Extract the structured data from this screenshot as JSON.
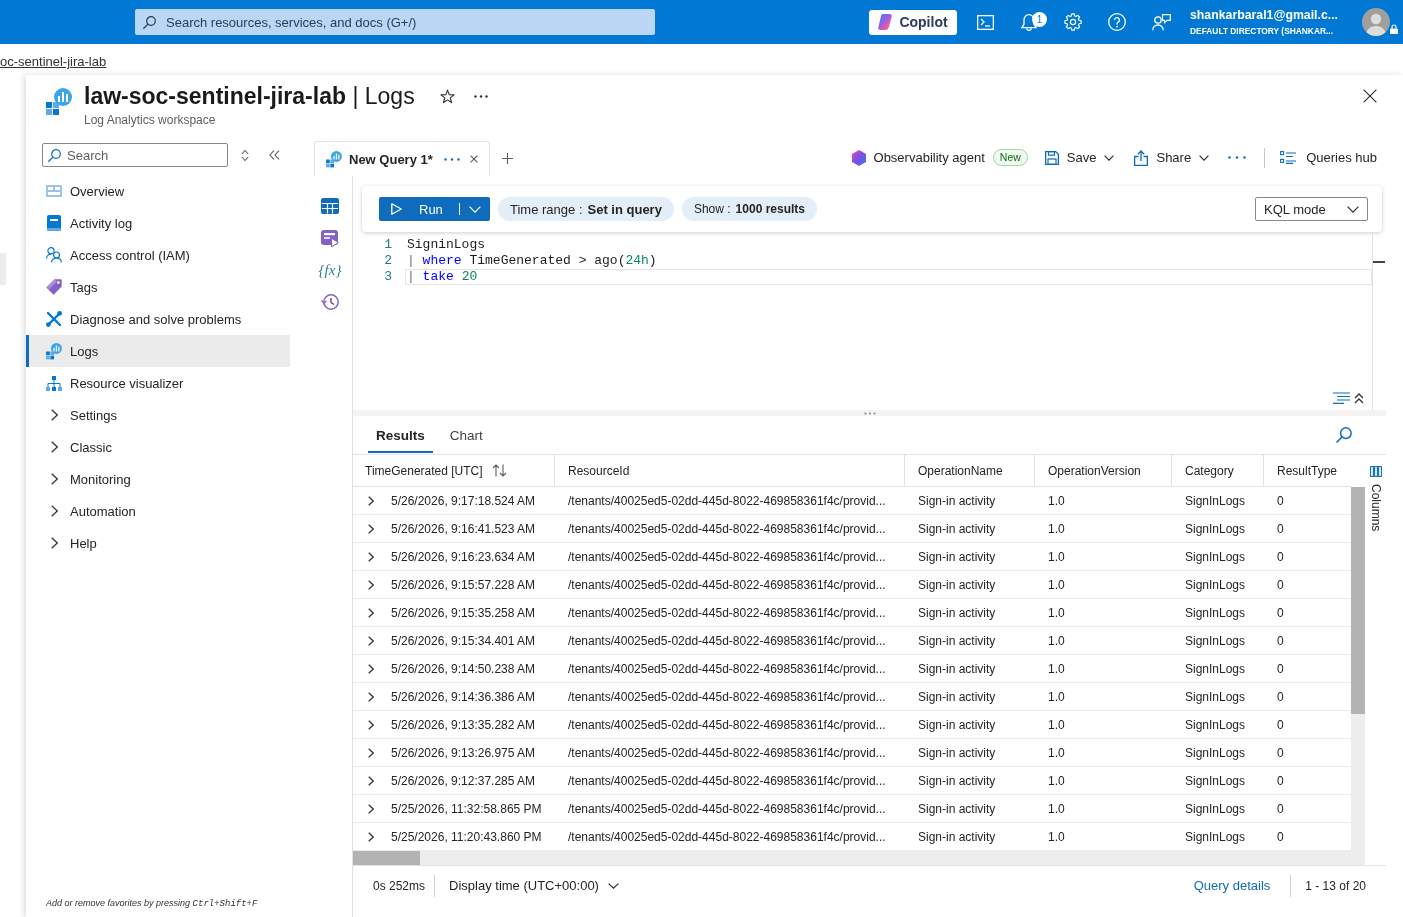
{
  "top_bar": {
    "search": {
      "placeholder": "Search resources, services, and docs (G+/)"
    },
    "copilot": "Copilot",
    "notification_count": "1",
    "account": {
      "email": "shankarbaral1@gmail.c...",
      "directory": "DEFAULT DIRECTORY (SHANKAR..."
    }
  },
  "breadcrumb": [
    {
      "label": "oc-sentinel-jira-lab"
    }
  ],
  "header": {
    "title": "**law-soc-sentinel-jira-lab** | Logs",
    "subtitle": "Log Analytics workspace"
  },
  "sidebar": {
    "search": {
      "placeholder": "Search"
    },
    "items": [
      {
        "label": "Overview",
        "kind": "link",
        "selected": false
      },
      {
        "label": "Activity log",
        "kind": "link",
        "selected": false
      },
      {
        "label": "Access control (IAM)",
        "kind": "link",
        "selected": false
      },
      {
        "label": "Tags",
        "kind": "link",
        "selected": false
      },
      {
        "label": "Diagnose and solve problems",
        "kind": "link",
        "selected": false
      },
      {
        "label": "Logs",
        "kind": "link",
        "selected": true
      },
      {
        "label": "Resource visualizer",
        "kind": "link",
        "selected": false
      },
      {
        "label": "Settings",
        "kind": "group",
        "selected": false,
        "expanded": false
      },
      {
        "label": "Classic",
        "kind": "group",
        "selected": false,
        "expanded": false
      },
      {
        "label": "Monitoring",
        "kind": "group",
        "selected": false,
        "expanded": false
      },
      {
        "label": "Automation",
        "kind": "group",
        "selected": false,
        "expanded": false
      },
      {
        "label": "Help",
        "kind": "group",
        "selected": false,
        "expanded": false
      }
    ],
    "hint": {
      "text": "Add or remove favorites by pressing",
      "shortcut": "Ctrl+Shift+F"
    }
  },
  "query_tabs": [
    {
      "label": "New Query 1*",
      "selected": true
    }
  ],
  "toolbar": {
    "agent": {
      "label": "Observability agent",
      "badge": "New"
    },
    "save": "Save",
    "share": "Share",
    "queries_hub": "Queries hub"
  },
  "rail": [
    {
      "kind": "tables"
    },
    {
      "kind": "queries"
    },
    {
      "kind": "functions",
      "label": "{fx}"
    },
    {
      "kind": "history"
    }
  ],
  "query_bar": {
    "run": "Run",
    "time_range": {
      "label": "Time range :",
      "value": "Set in query"
    },
    "show": {
      "label": "Show :",
      "value": "1000 results"
    },
    "mode": "KQL mode"
  },
  "editor": {
    "lines": [
      {
        "number": "1",
        "selected": false,
        "tokens": [
          {
            "kind": "plain",
            "text": "SigninLogs"
          }
        ]
      },
      {
        "number": "2",
        "selected": false,
        "tokens": [
          {
            "kind": "pipe",
            "text": "| "
          },
          {
            "kind": "keyword",
            "text": "where"
          },
          {
            "kind": "plain",
            "text": " TimeGenerated > ago("
          },
          {
            "kind": "number",
            "text": "24h"
          },
          {
            "kind": "plain",
            "text": ")"
          }
        ]
      },
      {
        "number": "3",
        "selected": true,
        "tokens": [
          {
            "kind": "pipe",
            "text": "| "
          },
          {
            "kind": "keyword",
            "text": "take"
          },
          {
            "kind": "number",
            "text": " 20"
          }
        ]
      }
    ]
  },
  "result_tabs": [
    {
      "label": "Results",
      "selected": true
    },
    {
      "label": "Chart",
      "selected": false
    }
  ],
  "table": {
    "columns": [
      {
        "label": "TimeGenerated [UTC]",
        "sort_indicator": true
      },
      {
        "label": "ResourceId",
        "sort_indicator": false
      },
      {
        "label": "OperationName",
        "sort_indicator": false
      },
      {
        "label": "OperationVersion",
        "sort_indicator": false
      },
      {
        "label": "Category",
        "sort_indicator": false
      },
      {
        "label": "ResultType",
        "sort_indicator": false
      }
    ],
    "rows": [
      {
        "expanded": false,
        "cells": [
          "5/26/2026, 9:17:18.524 AM",
          "/tenants/40025ed5-02dd-445d-8022-469858361f4c/provid...",
          "Sign-in activity",
          "1.0",
          "SignInLogs",
          "0"
        ]
      },
      {
        "expanded": false,
        "cells": [
          "5/26/2026, 9:16:41.523 AM",
          "/tenants/40025ed5-02dd-445d-8022-469858361f4c/provid...",
          "Sign-in activity",
          "1.0",
          "SignInLogs",
          "0"
        ]
      },
      {
        "expanded": false,
        "cells": [
          "5/26/2026, 9:16:23.634 AM",
          "/tenants/40025ed5-02dd-445d-8022-469858361f4c/provid...",
          "Sign-in activity",
          "1.0",
          "SignInLogs",
          "0"
        ]
      },
      {
        "expanded": false,
        "cells": [
          "5/26/2026, 9:15:57.228 AM",
          "/tenants/40025ed5-02dd-445d-8022-469858361f4c/provid...",
          "Sign-in activity",
          "1.0",
          "SignInLogs",
          "0"
        ]
      },
      {
        "expanded": false,
        "cells": [
          "5/26/2026, 9:15:35.258 AM",
          "/tenants/40025ed5-02dd-445d-8022-469858361f4c/provid...",
          "Sign-in activity",
          "1.0",
          "SignInLogs",
          "0"
        ]
      },
      {
        "expanded": false,
        "cells": [
          "5/26/2026, 9:15:34.401 AM",
          "/tenants/40025ed5-02dd-445d-8022-469858361f4c/provid...",
          "Sign-in activity",
          "1.0",
          "SignInLogs",
          "0"
        ]
      },
      {
        "expanded": false,
        "cells": [
          "5/26/2026, 9:14:50.238 AM",
          "/tenants/40025ed5-02dd-445d-8022-469858361f4c/provid...",
          "Sign-in activity",
          "1.0",
          "SignInLogs",
          "0"
        ]
      },
      {
        "expanded": false,
        "cells": [
          "5/26/2026, 9:14:36.386 AM",
          "/tenants/40025ed5-02dd-445d-8022-469858361f4c/provid...",
          "Sign-in activity",
          "1.0",
          "SignInLogs",
          "0"
        ]
      },
      {
        "expanded": false,
        "cells": [
          "5/26/2026, 9:13:35.282 AM",
          "/tenants/40025ed5-02dd-445d-8022-469858361f4c/provid...",
          "Sign-in activity",
          "1.0",
          "SignInLogs",
          "0"
        ]
      },
      {
        "expanded": false,
        "cells": [
          "5/26/2026, 9:13:26.975 AM",
          "/tenants/40025ed5-02dd-445d-8022-469858361f4c/provid...",
          "Sign-in activity",
          "1.0",
          "SignInLogs",
          "0"
        ]
      },
      {
        "expanded": false,
        "cells": [
          "5/26/2026, 9:12:37.285 AM",
          "/tenants/40025ed5-02dd-445d-8022-469858361f4c/provid...",
          "Sign-in activity",
          "1.0",
          "SignInLogs",
          "0"
        ]
      },
      {
        "expanded": false,
        "cells": [
          "5/25/2026, 11:32:58.865 PM",
          "/tenants/40025ed5-02dd-445d-8022-469858361f4c/provid...",
          "Sign-in activity",
          "1.0",
          "SignInLogs",
          "0"
        ]
      },
      {
        "expanded": false,
        "cells": [
          "5/25/2026, 11:20:43.860 PM",
          "/tenants/40025ed5-02dd-445d-8022-469858361f4c/provid...",
          "Sign-in activity",
          "1.0",
          "SignInLogs",
          "0"
        ]
      }
    ]
  },
  "columns_panel": "Columns",
  "status_bar": {
    "duration": "0s 252ms",
    "display_time": "Display time (UTC+00:00)",
    "query_details": "Query details",
    "range": "1 - 13 of 20"
  }
}
